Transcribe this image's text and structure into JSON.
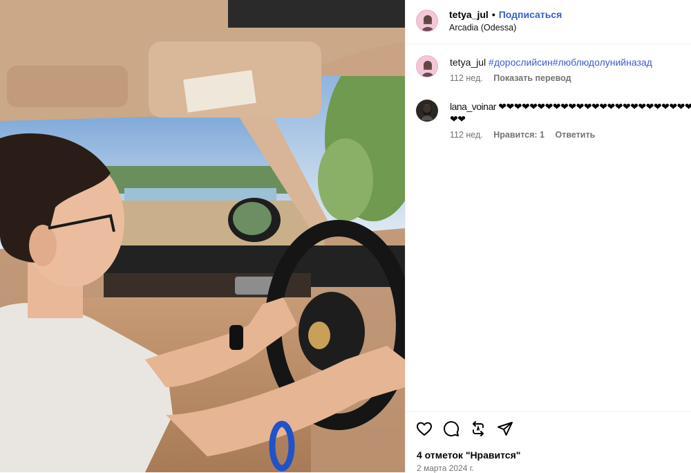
{
  "post": {
    "author": "tetya_jul",
    "separator": "•",
    "follow_label": "Подписаться",
    "location": "Arcadia (Odessa)"
  },
  "comments": [
    {
      "user": "tetya_jul",
      "text": "#дорослийсин#люблюдолунийназад",
      "time": "112 нед.",
      "action": "Показать перевод"
    },
    {
      "user": "lana_voinar",
      "hearts_line1": "❤❤❤❤❤❤❤❤❤❤❤❤❤❤❤❤❤❤❤❤❤❤❤❤❤",
      "hearts_line2": "❤❤",
      "time": "112 нед.",
      "likes_label": "Нравится: 1",
      "reply_label": "Ответить"
    }
  ],
  "footer": {
    "likes": "4 отметок \"Нравится\"",
    "date": "2 марта 2024 г."
  },
  "icons": {
    "like": "heart-icon",
    "comment": "comment-icon",
    "repost": "repost-icon",
    "share": "send-icon"
  },
  "colors": {
    "link": "#3a5bd1",
    "muted": "#737373",
    "divider": "#efefef"
  }
}
